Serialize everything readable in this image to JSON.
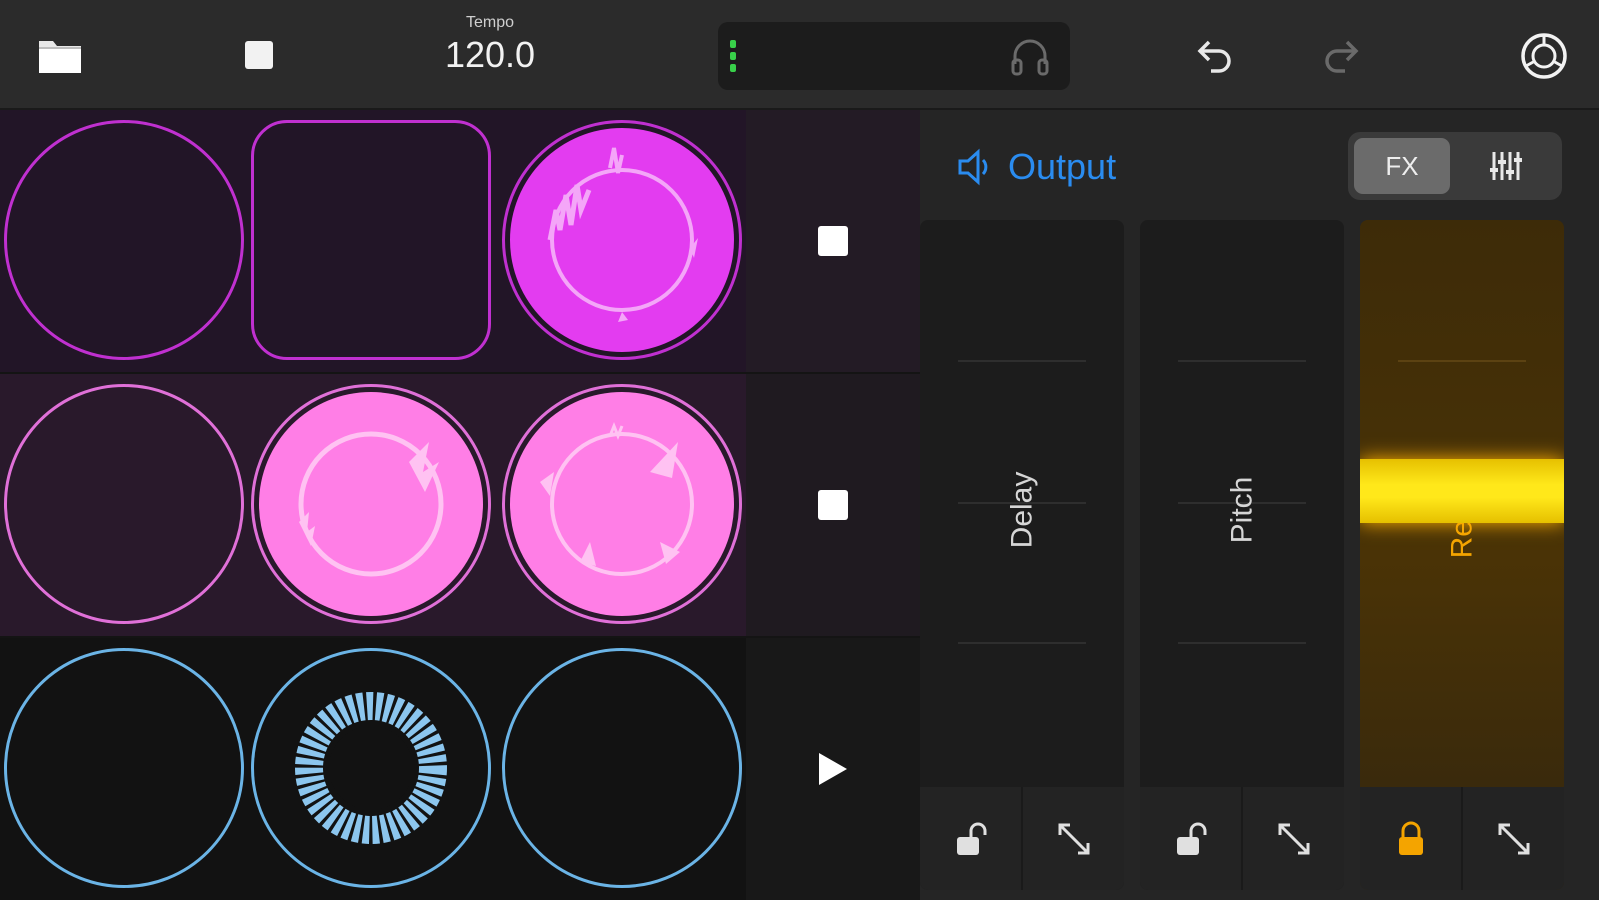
{
  "toolbar": {
    "tempo_label": "Tempo",
    "tempo_value": "120.0",
    "icons": [
      "folder-icon",
      "stop-icon",
      "headphones-icon",
      "undo-icon",
      "redo-icon",
      "settings-icon"
    ]
  },
  "colors": {
    "purple": "#c030d0",
    "purple_fill": "#e33cf0",
    "pink": "#e070d8",
    "pink_fill": "#ff7ee6",
    "blue": "#6bb4e6",
    "blue_wave": "#8cc6ee",
    "accent_blue": "#2a8cf0",
    "reverb": "#f4a400",
    "reverb_handle": "#ffe01a",
    "meter_green": "#38d04a"
  },
  "grid": {
    "rows": [
      {
        "color": "purple",
        "pads": [
          {
            "shape": "circle",
            "state": "empty"
          },
          {
            "shape": "rounded",
            "state": "empty"
          },
          {
            "shape": "circle",
            "state": "playing"
          }
        ],
        "control": "stop"
      },
      {
        "color": "pink",
        "pads": [
          {
            "shape": "circle",
            "state": "empty"
          },
          {
            "shape": "circle",
            "state": "playing"
          },
          {
            "shape": "circle",
            "state": "playing"
          }
        ],
        "control": "stop"
      },
      {
        "color": "blue",
        "pads": [
          {
            "shape": "circle",
            "state": "empty"
          },
          {
            "shape": "circle",
            "state": "recorded"
          },
          {
            "shape": "circle",
            "state": "empty"
          }
        ],
        "control": "play"
      }
    ]
  },
  "output": {
    "title": "Output",
    "tab_fx": "FX",
    "tab_mixer_icon": "mixer-icon",
    "strips": [
      {
        "name": "Delay",
        "locked": false,
        "active": false
      },
      {
        "name": "Pitch",
        "locked": false,
        "active": false
      },
      {
        "name": "Reverb",
        "locked": true,
        "active": true,
        "level": 0.52
      }
    ]
  }
}
